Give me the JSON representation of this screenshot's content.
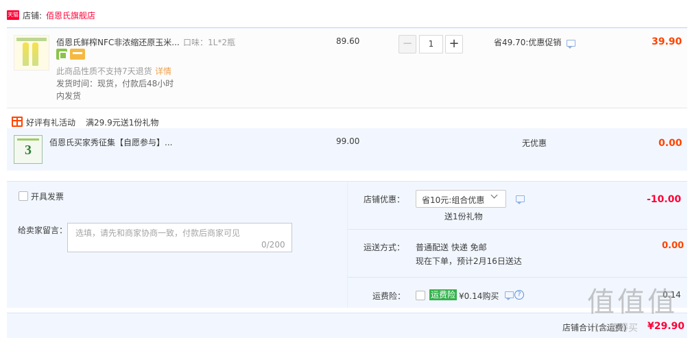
{
  "shop": {
    "badge": "天猫",
    "label": "店铺:",
    "name": "佰恩氏旗舰店"
  },
  "items": [
    {
      "title": "佰恩氏鲜榨NFC非浓缩还原玉米...",
      "sku": "口味：1L*2瓶",
      "no_return": "此商品性质不支持7天退货",
      "detail_link": "详情",
      "ship_time": "发货时间：现货，付款后48小时内发货",
      "unit_price": "89.60",
      "quantity": "1",
      "promo": "省49.70:优惠促销",
      "subtotal": "39.90"
    },
    {
      "title": "佰恩氏买家秀征集【自愿参与】...",
      "thumb_number": "3",
      "unit_price": "99.00",
      "promo": "无优惠",
      "subtotal": "0.00"
    }
  ],
  "gift_activity": {
    "title": "好评有礼活动",
    "rule": "满29.9元送1份礼物"
  },
  "stepper": {
    "minus": "−",
    "plus": "+"
  },
  "invoice": {
    "label": "开具发票"
  },
  "message": {
    "label": "给卖家留言：",
    "placeholder": "选填，请先和商家协商一致，付款后商家可见",
    "count": "0/200"
  },
  "shop_discount": {
    "label": "店铺优惠：",
    "selected": "省10元:组合优惠",
    "gift": "送1份礼物",
    "value": "-10.00"
  },
  "shipping": {
    "label": "运送方式：",
    "method": "普通配送 快递 免邮",
    "eta": "现在下单，预计2月16日送达",
    "value": "0.00"
  },
  "insurance": {
    "label": "运费险：",
    "tag": "运费险",
    "price": "¥0.14购买",
    "help": "?",
    "value": "0.14"
  },
  "total": {
    "label": "店铺合计(含运费)",
    "value": "¥29.90"
  },
  "watermark": {
    "chars": "值值值",
    "url": "什么值得买"
  },
  "colors": {
    "brand": "#ff0036",
    "price": "#ff4400",
    "panel": "#f2f7ff",
    "insurance_tag": "#34b24c"
  }
}
